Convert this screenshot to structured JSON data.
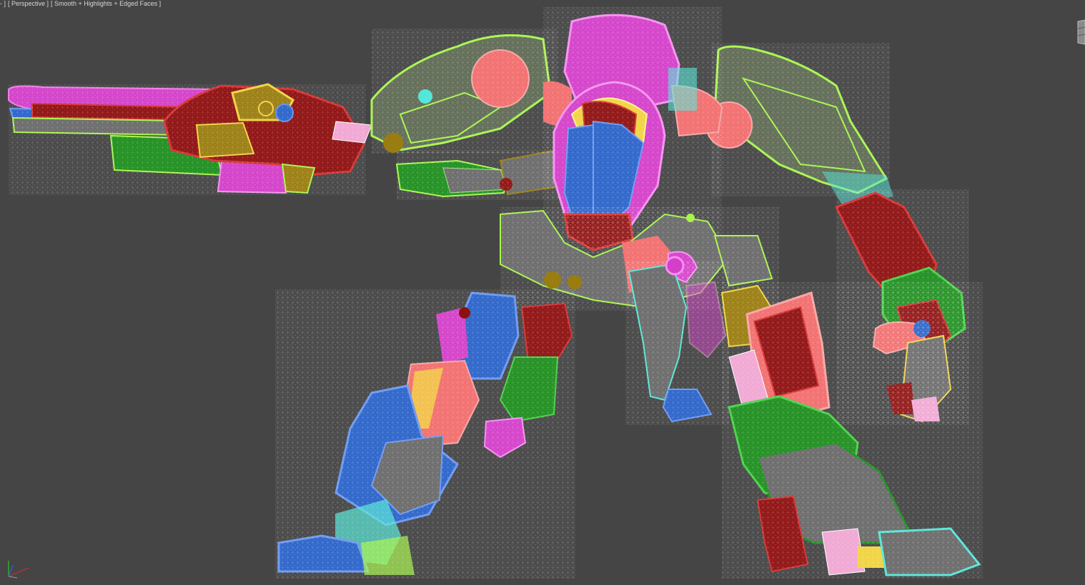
{
  "viewport": {
    "label_parts": [
      {
        "text": "- ]",
        "id": "viewport-menu"
      },
      {
        "text": "[ Perspective ]",
        "id": "point-of-view-menu"
      },
      {
        "text": "[ Smooth + Highlights + Edged Faces ]",
        "id": "shading-menu"
      }
    ],
    "background": "#454545"
  },
  "scene": {
    "object": "mech-robot-wireframe",
    "palette": {
      "lime": "#a6f54a",
      "magenta": "#d43fc9",
      "red": "#8f1010",
      "salmon": "#f26d6d",
      "blue": "#2b63c9",
      "cyan": "#54e6d7",
      "green": "#1e8f1e",
      "olive": "#9a7d10",
      "yellow": "#f1d33f",
      "pink": "#f0a6d3",
      "gray": "#6a6a6a"
    }
  },
  "gizmo": {
    "icon": "axis-tripod-icon"
  },
  "viewcube": {
    "icon": "viewcube-icon"
  }
}
